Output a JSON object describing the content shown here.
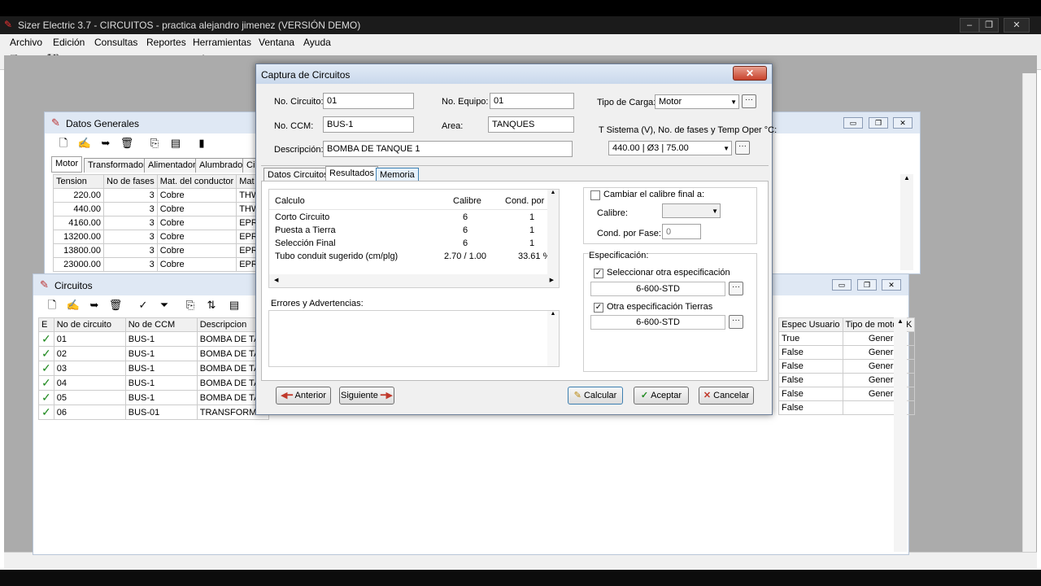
{
  "app": {
    "title": "Sizer Electric 3.7 - CIRCUITOS - practica alejandro jimenez (VERSIÓN DEMO)"
  },
  "menu": [
    "Archivo",
    "Edición",
    "Consultas",
    "Reportes",
    "Herramientas",
    "Ventana",
    "Ayuda"
  ],
  "datos_generales": {
    "title": "Datos Generales",
    "tabs": [
      "Motor",
      "Transformador",
      "Alimentador",
      "Alumbrado",
      "Cir"
    ],
    "columns": [
      "Tension",
      "No de fases",
      "Mat. del conductor",
      "Mat del"
    ],
    "rows": [
      [
        "220.00",
        "3",
        "Cobre",
        "THW"
      ],
      [
        "440.00",
        "3",
        "Cobre",
        "THW"
      ],
      [
        "4160.00",
        "3",
        "Cobre",
        "EPR"
      ],
      [
        "13200.00",
        "3",
        "Cobre",
        "EPR"
      ],
      [
        "13800.00",
        "3",
        "Cobre",
        "EPR"
      ],
      [
        "23000.00",
        "3",
        "Cobre",
        "EPR"
      ]
    ]
  },
  "circuitos": {
    "title": "Circuitos",
    "columns": [
      "E",
      "No de circuito",
      "No de CCM",
      "Descripcion"
    ],
    "right_columns": [
      "Espec Usuario",
      "Tipo de motor",
      "K"
    ],
    "rows": [
      {
        "num": "01",
        "ccm": "BUS-1",
        "desc": "BOMBA DE TAN",
        "espec": "True",
        "tipo": "General"
      },
      {
        "num": "02",
        "ccm": "BUS-1",
        "desc": "BOMBA DE TAN",
        "espec": "False",
        "tipo": "General"
      },
      {
        "num": "03",
        "ccm": "BUS-1",
        "desc": "BOMBA DE TAN",
        "espec": "False",
        "tipo": "General"
      },
      {
        "num": "04",
        "ccm": "BUS-1",
        "desc": "BOMBA DE TAN",
        "espec": "False",
        "tipo": "General"
      },
      {
        "num": "05",
        "ccm": "BUS-1",
        "desc": "BOMBA DE TAN",
        "espec": "False",
        "tipo": "General"
      },
      {
        "num": "06",
        "ccm": "BUS-01",
        "desc": "TRANSFORMA",
        "espec": "False",
        "tipo": ""
      }
    ]
  },
  "dialog": {
    "title": "Captura de Circuitos",
    "close": "✕",
    "no_circuito_label": "No. Circuito:",
    "no_circuito": "01",
    "no_equipo_label": "No. Equipo:",
    "no_equipo": "01",
    "tipo_carga_label": "Tipo de Carga:",
    "tipo_carga": "Motor",
    "no_ccm_label": "No. CCM:",
    "no_ccm": "BUS-1",
    "area_label": "Area:",
    "area": "TANQUES",
    "t_sistema_label": "T Sistema (V), No. de fases y Temp Oper °C:",
    "t_sistema": "440.00   | Ø3 | 75.00",
    "descripcion_label": "Descripción:",
    "descripcion": "BOMBA DE TANQUE 1",
    "tabs": [
      "Datos Circuitos",
      "Resultados",
      "Memoria"
    ],
    "results": {
      "columns": [
        "Calculo",
        "Calibre",
        "Cond. por Fase"
      ],
      "rows": [
        [
          "Corto Circuito",
          "6",
          "1"
        ],
        [
          "Puesta a Tierra",
          "6",
          "1"
        ],
        [
          "Selección Final",
          "6",
          "1"
        ],
        [
          "Tubo conduit sugerido (cm/plg)",
          "2.70 / 1.00",
          "33.61 %"
        ]
      ]
    },
    "errores_label": "Errores y Advertencias:",
    "cambiar_calibre_label": "Cambiar el calibre final a:",
    "calibre_label": "Calibre:",
    "cond_fase_label": "Cond. por Fase:",
    "cond_fase_value": "0",
    "especificacion_label": "Especificación:",
    "sel_otra_espec_label": "Seleccionar otra especificación",
    "espec_value": "6-600-STD",
    "otra_espec_tierras_label": "Otra especificación Tierras",
    "espec_tierras_value": "6-600-STD",
    "btn_anterior": "Anterior",
    "btn_siguiente": "Siguiente",
    "btn_calcular": "Calcular",
    "btn_aceptar": "Aceptar",
    "btn_cancelar": "Cancelar"
  }
}
